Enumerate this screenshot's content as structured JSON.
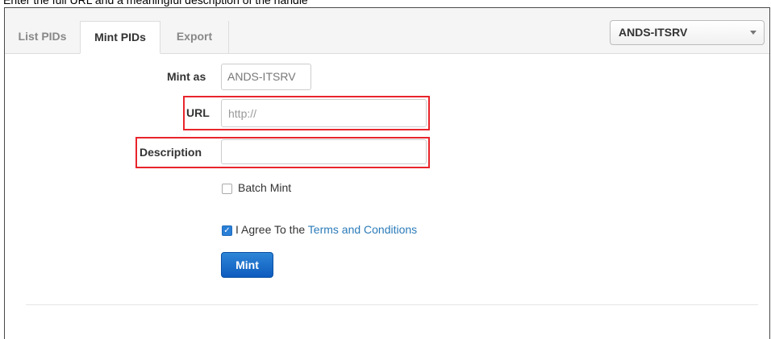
{
  "caption": "Enter the full URL and a meaningful description of the handle",
  "tabs": [
    {
      "label": "List PIDs",
      "active": false
    },
    {
      "label": "Mint PIDs",
      "active": true
    },
    {
      "label": "Export",
      "active": false
    }
  ],
  "identity_select": {
    "selected": "ANDS-ITSRV"
  },
  "form": {
    "mint_as": {
      "label": "Mint as",
      "value": "ANDS-ITSRV"
    },
    "url": {
      "label": "URL",
      "value": "",
      "placeholder": "http://"
    },
    "description": {
      "label": "Description",
      "value": "",
      "placeholder": ""
    },
    "batch_mint": {
      "label": "Batch Mint",
      "checked": false
    },
    "agree": {
      "prefix": "I Agree To the ",
      "link": "Terms and Conditions",
      "checked": true
    },
    "submit_label": "Mint"
  },
  "highlight_color": "#e8252b",
  "accent_color": "#1a6fcf"
}
